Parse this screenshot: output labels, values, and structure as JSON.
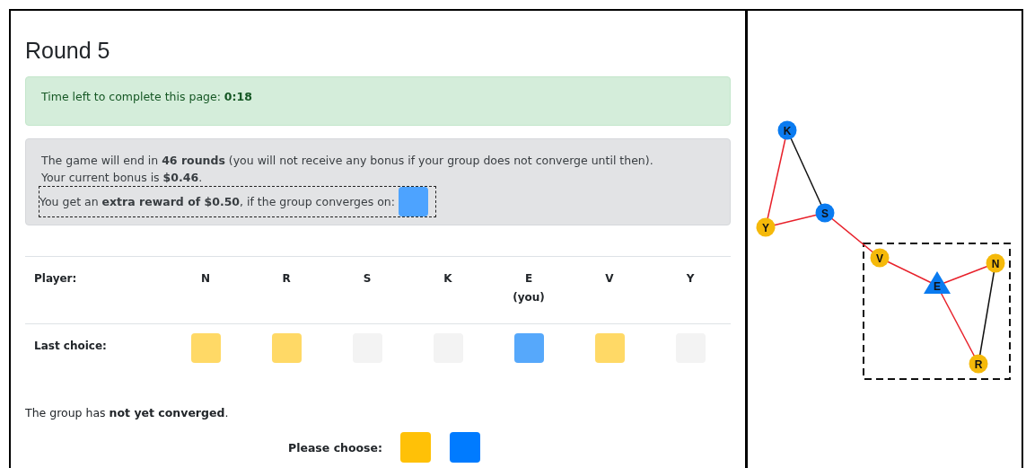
{
  "title": "Round 5",
  "timer": {
    "text": "Time left to complete this page: **0:18**"
  },
  "info": {
    "lines": [
      "The game will end in **46 rounds** (you will not receive any bonus if your group does not converge until then).",
      "Your current bonus is **$0.46**."
    ],
    "reward": {
      "text": "You get an **extra reward of $0.50**, if the group converges on:",
      "color": "#4da3ff"
    }
  },
  "table": {
    "row_labels": [
      "Player:",
      "Last choice:"
    ],
    "players": [
      {
        "name": "N",
        "color": "#ffd966"
      },
      {
        "name": "R",
        "color": "#ffd966"
      },
      {
        "name": "S",
        "color": "#f3f3f3"
      },
      {
        "name": "K",
        "color": "#f3f3f3"
      },
      {
        "name": "E",
        "note": "(you)",
        "color": "#56a8fb"
      },
      {
        "name": "V",
        "color": "#ffd966"
      },
      {
        "name": "Y",
        "color": "#f3f3f3"
      }
    ]
  },
  "status": "The group has **not yet converged**.",
  "choose": {
    "label": "Please choose:",
    "options": [
      {
        "color": "#ffc107"
      },
      {
        "color": "#007bff"
      }
    ]
  },
  "network": {
    "nodes": [
      {
        "label": "K",
        "kind": "circle",
        "color": "#0a7bf0"
      },
      {
        "label": "S",
        "kind": "circle",
        "color": "#0a7bf0"
      },
      {
        "label": "Y",
        "kind": "circle",
        "color": "#f5b90a"
      },
      {
        "label": "V",
        "kind": "circle",
        "color": "#f5b90a"
      },
      {
        "label": "E",
        "kind": "triangle",
        "color": "#0a7bf0"
      },
      {
        "label": "N",
        "kind": "circle",
        "color": "#f5b90a"
      },
      {
        "label": "R",
        "kind": "circle",
        "color": "#f5b90a"
      }
    ],
    "edges": [
      {
        "color": "#e8202a"
      },
      {
        "color": "#111111"
      },
      {
        "color": "#e8202a"
      },
      {
        "color": "#e8202a"
      },
      {
        "color": "#e8202a"
      },
      {
        "color": "#e8202a"
      },
      {
        "color": "#111111"
      },
      {
        "color": "#e8202a"
      }
    ]
  }
}
